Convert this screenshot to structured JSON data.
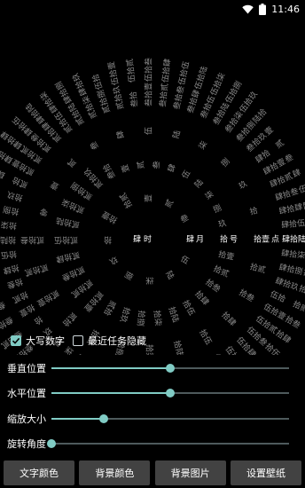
{
  "status_bar": {
    "time": "11:46",
    "icons": [
      "wifi-icon",
      "battery-icon"
    ]
  },
  "clock": {
    "center": {
      "hour": "肆",
      "hour_unit": "时"
    },
    "rings": [
      {
        "name": "month",
        "unit": "月",
        "items": [
          "壹",
          "贰",
          "叁",
          "肆",
          "伍",
          "陆",
          "柒",
          "捌",
          "玖",
          "拾",
          "拾壹",
          "拾贰"
        ],
        "current": "肆"
      },
      {
        "name": "day",
        "unit": "号",
        "items": [
          "壹",
          "贰",
          "叁",
          "肆",
          "伍",
          "陆",
          "柒",
          "捌",
          "玖",
          "拾",
          "拾壹",
          "拾贰",
          "拾叁",
          "拾肆",
          "拾伍",
          "拾陆",
          "拾柒",
          "拾捌",
          "拾玖",
          "贰拾",
          "贰拾壹",
          "贰拾贰",
          "贰拾叁",
          "贰拾肆",
          "贰拾伍",
          "贰拾陆",
          "贰拾柒",
          "贰拾捌",
          "贰拾玖",
          "叁拾"
        ],
        "current": "拾"
      },
      {
        "name": "hour",
        "unit": "点",
        "items": [
          "零",
          "壹",
          "贰",
          "叁",
          "肆",
          "伍",
          "陆",
          "柒",
          "捌",
          "玖",
          "拾",
          "拾壹",
          "拾贰",
          "拾叁",
          "拾肆",
          "拾伍",
          "拾陆",
          "拾柒",
          "拾捌",
          "拾玖",
          "贰拾",
          "贰拾壹",
          "贰拾贰",
          "贰拾叁"
        ],
        "current": "拾壹"
      },
      {
        "name": "minute",
        "unit": "分",
        "items": [
          "壹",
          "贰",
          "叁",
          "肆",
          "伍",
          "陆",
          "柒",
          "捌",
          "玖",
          "拾",
          "拾壹",
          "拾贰",
          "拾叁",
          "拾肆",
          "拾伍",
          "拾陆",
          "拾柒",
          "拾捌",
          "拾玖",
          "贰拾",
          "贰拾壹",
          "贰拾贰",
          "贰拾叁",
          "贰拾肆",
          "贰拾伍",
          "贰拾陆",
          "贰拾柒",
          "贰拾捌",
          "贰拾玖",
          "叁拾",
          "叁拾壹",
          "叁拾贰",
          "叁拾叁",
          "叁拾肆",
          "叁拾伍",
          "叁拾陆",
          "叁拾柒",
          "叁拾捌",
          "叁拾玖",
          "肆拾",
          "肆拾壹",
          "肆拾贰",
          "肆拾叁",
          "肆拾肆",
          "肆拾伍",
          "肆拾陆",
          "肆拾柒",
          "肆拾捌",
          "肆拾玖",
          "伍拾",
          "伍拾壹",
          "伍拾贰",
          "伍拾叁",
          "伍拾肆",
          "伍拾伍",
          "伍拾陆",
          "伍拾柒",
          "伍拾捌",
          "伍拾玖",
          "陆拾"
        ],
        "current": "肆拾陆"
      },
      {
        "name": "second",
        "unit": "秒",
        "items": [
          "壹",
          "贰",
          "叁",
          "肆",
          "伍",
          "陆",
          "柒",
          "捌",
          "玖",
          "拾",
          "拾壹",
          "拾贰",
          "拾叁",
          "拾肆",
          "拾伍",
          "拾陆",
          "拾柒",
          "拾捌",
          "拾玖",
          "贰拾",
          "贰拾壹",
          "贰拾贰",
          "贰拾叁",
          "贰拾肆",
          "贰拾伍",
          "贰拾陆",
          "贰拾柒",
          "贰拾捌",
          "贰拾玖",
          "叁拾",
          "叁拾壹",
          "叁拾贰",
          "叁拾叁",
          "叁拾肆",
          "叁拾伍",
          "叁拾陆",
          "叁拾柒",
          "叁拾捌",
          "叁拾玖",
          "肆拾",
          "肆拾壹",
          "肆拾贰",
          "肆拾叁",
          "肆拾肆",
          "肆拾伍",
          "肆拾陆",
          "肆拾柒",
          "肆拾捌",
          "肆拾玖",
          "伍拾",
          "伍拾壹",
          "伍拾贰",
          "伍拾叁",
          "伍拾肆",
          "伍拾伍",
          "伍拾陆",
          "伍拾柒",
          "伍拾捌",
          "伍拾玖",
          "陆拾"
        ],
        "current": "捌"
      }
    ],
    "highlight_color": "#ffffff",
    "dim_color": "#8a8a8a"
  },
  "options": {
    "uppercase_numbers": {
      "label": "大写数字",
      "checked": true
    },
    "hide_recent": {
      "label": "最近任务隐藏",
      "checked": false
    }
  },
  "sliders": [
    {
      "label": "垂直位置",
      "value": 0.5
    },
    {
      "label": "水平位置",
      "value": 0.5
    },
    {
      "label": "缩放大小",
      "value": 0.22
    },
    {
      "label": "旋转角度",
      "value": 0.0
    }
  ],
  "buttons": {
    "text_color": "文字颜色",
    "bg_color": "背景颜色",
    "bg_image": "背景图片",
    "set_wallpaper": "设置壁纸"
  },
  "accent_color": "#80cbc4"
}
